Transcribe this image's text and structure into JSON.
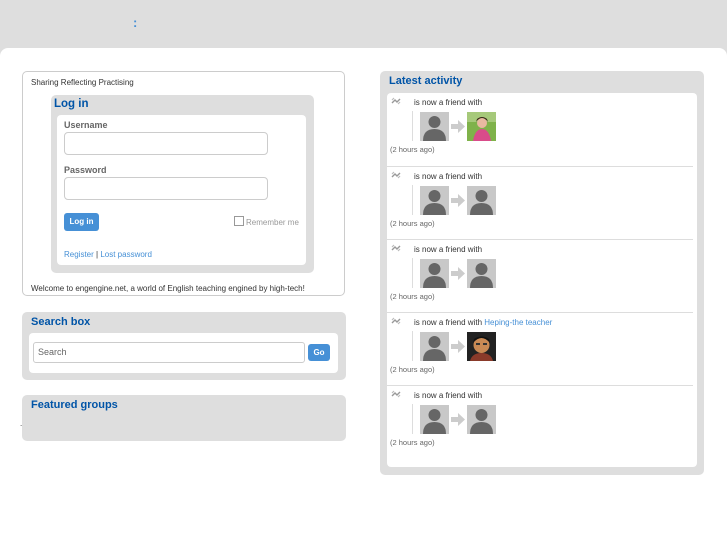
{
  "header": {
    "separator": ":"
  },
  "intro": {
    "tagline": "Sharing Reflecting Practising",
    "welcome": "Welcome to engengine.net, a world of English teaching engined by high-tech!"
  },
  "login": {
    "title": "Log in",
    "username_label": "Username",
    "password_label": "Password",
    "submit_label": "Log in",
    "remember_label": "Remember me",
    "register_link": "Register",
    "link_separator": " | ",
    "lost_password_link": "Lost password"
  },
  "search": {
    "title": "Search box",
    "placeholder": "Search",
    "go_label": "Go"
  },
  "groups": {
    "title": "Featured groups",
    "dot": "."
  },
  "activity": {
    "title": "Latest activity",
    "items": [
      {
        "text": "is now a friend with",
        "friend": "",
        "time": "(2 hours ago)",
        "avatar2": "photo-girl"
      },
      {
        "text": "is now a friend with",
        "friend": "",
        "time": "(2 hours ago)",
        "avatar2": "default"
      },
      {
        "text": "is now a friend with",
        "friend": "",
        "time": "(2 hours ago)",
        "avatar2": "default"
      },
      {
        "text": "is now a friend with ",
        "friend": "Heping-the teacher",
        "time": "(2 hours ago)",
        "avatar2": "photo-man"
      },
      {
        "text": "is now a friend with",
        "friend": "",
        "time": "(2 hours ago)",
        "avatar2": "default"
      }
    ]
  },
  "colors": {
    "accent": "#4690d6",
    "title": "#0054a7",
    "panel": "#dedede"
  },
  "icons": {
    "friend": "friends-icon",
    "arrow": "arrow-right-icon",
    "avatar": "default-avatar-icon"
  }
}
